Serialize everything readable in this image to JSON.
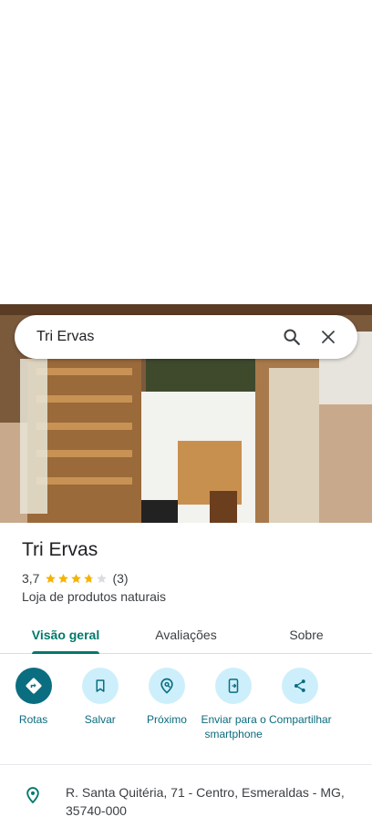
{
  "search": {
    "query": "Tri Ervas"
  },
  "place": {
    "name": "Tri Ervas",
    "rating": "3,7",
    "rating_value": 3.7,
    "rating_max": 5,
    "review_count": "(3)",
    "category": "Loja de produtos naturais"
  },
  "tabs": [
    {
      "label": "Visão geral",
      "active": true
    },
    {
      "label": "Avaliações",
      "active": false
    },
    {
      "label": "Sobre",
      "active": false
    }
  ],
  "actions": [
    {
      "label": "Rotas",
      "icon": "directions-icon"
    },
    {
      "label": "Salvar",
      "icon": "bookmark-icon"
    },
    {
      "label": "Próximo",
      "icon": "nearby-icon"
    },
    {
      "label": "Enviar para o smartphone",
      "icon": "send-to-phone-icon"
    },
    {
      "label": "Compartilhar",
      "icon": "share-icon"
    }
  ],
  "address": {
    "text": "R. Santa Quitéria, 71 - Centro, Esmeraldas - MG, 35740-000"
  },
  "colors": {
    "accent": "#00796b",
    "primary_button": "#0b6e80",
    "action_circle": "#cdeffb",
    "star": "#f5b400"
  }
}
